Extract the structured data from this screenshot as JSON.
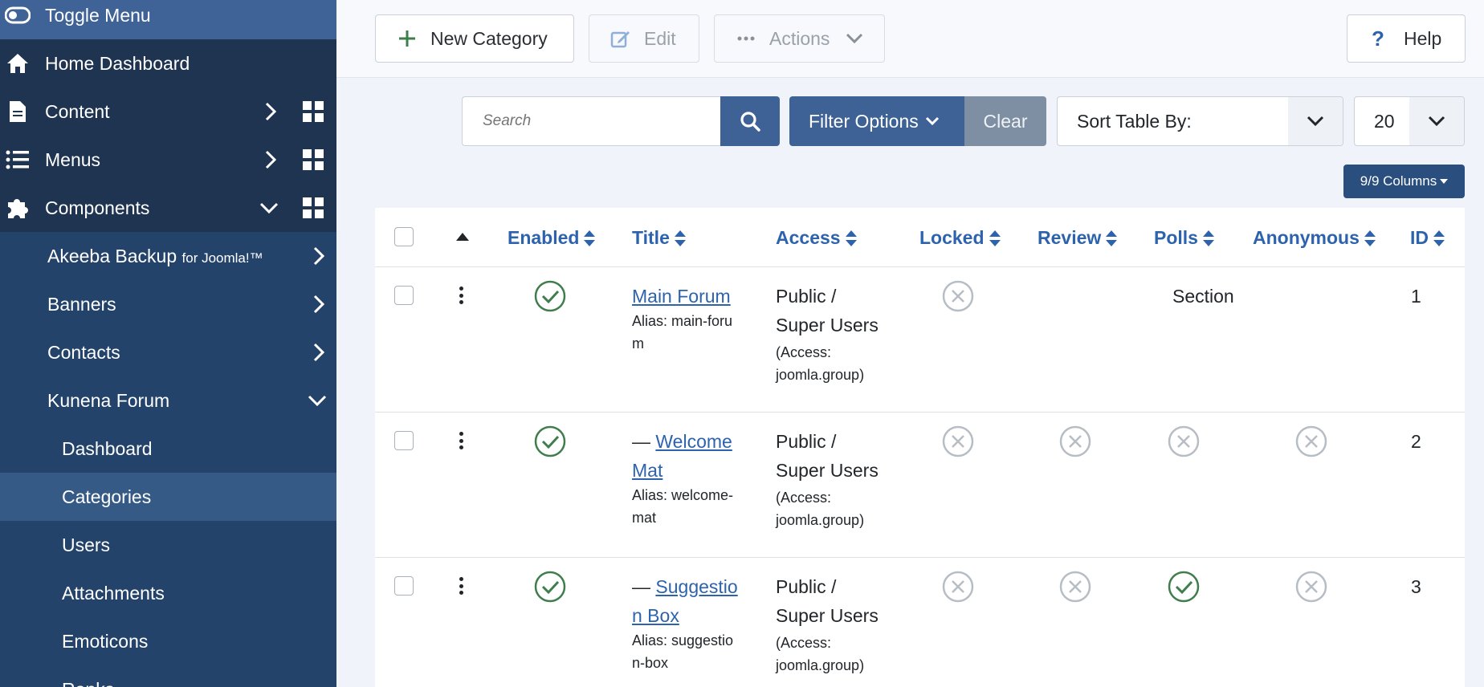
{
  "sidebar": {
    "toggle_label": "Toggle Menu",
    "items": [
      {
        "label": "Home Dashboard"
      },
      {
        "label": "Content"
      },
      {
        "label": "Menus"
      },
      {
        "label": "Components"
      }
    ],
    "components": [
      {
        "label": "Akeeba Backup",
        "suffix": "for Joomla!™"
      },
      {
        "label": "Banners"
      },
      {
        "label": "Contacts"
      },
      {
        "label": "Kunena Forum"
      }
    ],
    "kunena": [
      {
        "label": "Dashboard"
      },
      {
        "label": "Categories"
      },
      {
        "label": "Users"
      },
      {
        "label": "Attachments"
      },
      {
        "label": "Emoticons"
      },
      {
        "label": "Ranks"
      }
    ]
  },
  "toolbar": {
    "new_label": "New Category",
    "edit_label": "Edit",
    "actions_label": "Actions",
    "help_label": "Help"
  },
  "filters": {
    "search_placeholder": "Search",
    "filter_options_label": "Filter Options",
    "clear_label": "Clear",
    "sort_label": "Sort Table By:",
    "limit_value": "20",
    "columns_label": "9/9 Columns"
  },
  "table": {
    "headers": {
      "enabled": "Enabled",
      "title": "Title",
      "access": "Access",
      "locked": "Locked",
      "review": "Review",
      "polls": "Polls",
      "anonymous": "Anonymous",
      "id": "ID"
    },
    "rows": [
      {
        "prefix": "",
        "title": "Main Forum",
        "alias": "Alias: main-forum",
        "access_line1": "Public /",
        "access_line2": "Super Users",
        "access_note1": "(Access:",
        "access_note2": "joomla.group)",
        "section_label": "Section",
        "id": "1"
      },
      {
        "prefix": "— ",
        "title": "Welcome Mat",
        "alias": "Alias: welcome-mat",
        "access_line1": "Public /",
        "access_line2": "Super Users",
        "access_note1": "(Access:",
        "access_note2": "joomla.group)",
        "id": "2"
      },
      {
        "prefix": "— ",
        "title": "Suggestion Box",
        "alias": "Alias: suggestion-box",
        "access_line1": "Public /",
        "access_line2": "Super Users",
        "access_note1": "(Access:",
        "access_note2": "joomla.group)",
        "id": "3"
      }
    ]
  },
  "colors": {
    "sidebar_bg": "#1f3451",
    "accent": "#3e6296",
    "link": "#2d63ad",
    "enabled_green": "#3f7d4c",
    "disabled_gray": "#b7bdc4"
  }
}
